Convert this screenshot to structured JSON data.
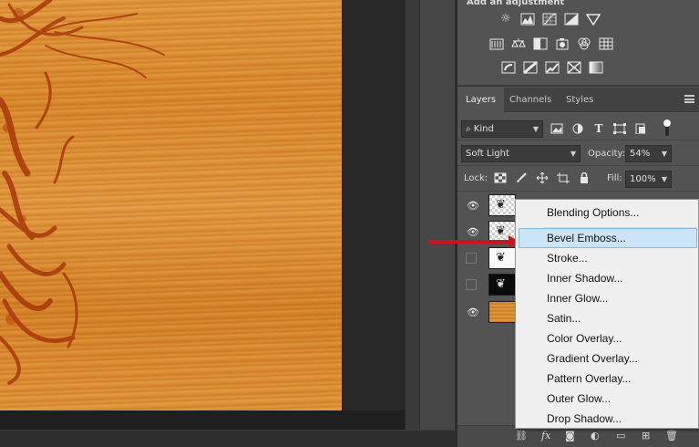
{
  "adjustments": {
    "title": "Add an adjustment",
    "row1": [
      "brightness-icon",
      "levels-icon",
      "curves-icon",
      "exposure-icon",
      "gradient-triangle-icon"
    ],
    "row2": [
      "vibrance-icon",
      "hue-saturation-icon",
      "color-balance-icon",
      "black-white-icon",
      "photo-filter-icon",
      "channel-mixer-icon",
      "color-lookup-icon"
    ],
    "row3": [
      "invert-icon",
      "posterize-icon",
      "threshold-icon",
      "selective-color-icon",
      "gradient-map-icon"
    ]
  },
  "tabs": [
    {
      "label": "Layers",
      "active": true
    },
    {
      "label": "Channels",
      "active": false
    },
    {
      "label": "Styles",
      "active": false
    }
  ],
  "filter": {
    "kind_label": "Kind"
  },
  "blend": {
    "mode": "Soft Light",
    "opacity_label": "Opacity:",
    "opacity_value": "54%"
  },
  "lock": {
    "label": "Lock:",
    "fill_label": "Fill:",
    "fill_value": "100%"
  },
  "layers": [
    {
      "visible": true,
      "thumb": "checker"
    },
    {
      "visible": true,
      "thumb": "checker"
    },
    {
      "visible": false,
      "thumb": "white"
    },
    {
      "visible": false,
      "thumb": "black"
    },
    {
      "visible": true,
      "thumb": "wood"
    }
  ],
  "context_menu": {
    "items": [
      {
        "label": "Blending Options...",
        "highlighted": false
      },
      {
        "label": "Bevel  Emboss...",
        "highlighted": true
      },
      {
        "label": "Stroke...",
        "highlighted": false
      },
      {
        "label": "Inner Shadow...",
        "highlighted": false
      },
      {
        "label": "Inner Glow...",
        "highlighted": false
      },
      {
        "label": "Satin...",
        "highlighted": false
      },
      {
        "label": "Color Overlay...",
        "highlighted": false
      },
      {
        "label": "Gradient Overlay...",
        "highlighted": false
      },
      {
        "label": "Pattern Overlay...",
        "highlighted": false
      },
      {
        "label": "Outer Glow...",
        "highlighted": false
      },
      {
        "label": "Drop Shadow...",
        "highlighted": false
      }
    ]
  },
  "colors": {
    "arrow": "#c8161d",
    "highlight": "#cce4f7",
    "panel": "#535353"
  }
}
